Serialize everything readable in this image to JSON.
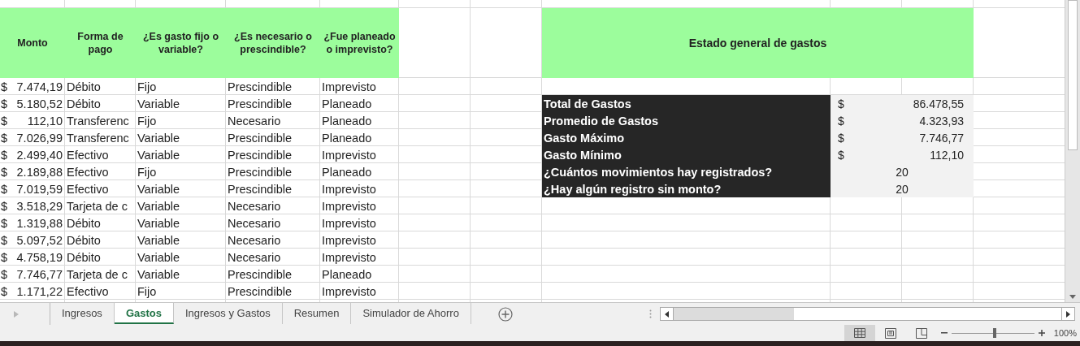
{
  "expense_table": {
    "columns": [
      {
        "label": "Monto"
      },
      {
        "label": "Forma de pago"
      },
      {
        "label": "¿Es gasto fijo o variable?"
      },
      {
        "label": "¿Es necesario o prescindible?"
      },
      {
        "label": "¿Fue planeado o imprevisto?"
      }
    ],
    "rows": [
      {
        "currency": "$",
        "amount": "7.474,19",
        "payment": "Débito",
        "type": "Fijo",
        "necessity": "Prescindible",
        "planning": "Imprevisto"
      },
      {
        "currency": "$",
        "amount": "5.180,52",
        "payment": "Débito",
        "type": "Variable",
        "necessity": "Prescindible",
        "planning": "Planeado"
      },
      {
        "currency": "$",
        "amount": "112,10",
        "payment": "Transferenc",
        "type": "Fijo",
        "necessity": "Necesario",
        "planning": "Planeado"
      },
      {
        "currency": "$",
        "amount": "7.026,99",
        "payment": "Transferenc",
        "type": "Variable",
        "necessity": "Prescindible",
        "planning": "Planeado"
      },
      {
        "currency": "$",
        "amount": "2.499,40",
        "payment": "Efectivo",
        "type": "Variable",
        "necessity": "Prescindible",
        "planning": "Imprevisto"
      },
      {
        "currency": "$",
        "amount": "2.189,88",
        "payment": "Efectivo",
        "type": "Fijo",
        "necessity": "Prescindible",
        "planning": "Planeado"
      },
      {
        "currency": "$",
        "amount": "7.019,59",
        "payment": "Efectivo",
        "type": "Variable",
        "necessity": "Prescindible",
        "planning": "Imprevisto"
      },
      {
        "currency": "$",
        "amount": "3.518,29",
        "payment": "Tarjeta de c",
        "type": "Variable",
        "necessity": "Necesario",
        "planning": "Imprevisto"
      },
      {
        "currency": "$",
        "amount": "1.319,88",
        "payment": "Débito",
        "type": "Variable",
        "necessity": "Necesario",
        "planning": "Imprevisto"
      },
      {
        "currency": "$",
        "amount": "5.097,52",
        "payment": "Débito",
        "type": "Variable",
        "necessity": "Necesario",
        "planning": "Imprevisto"
      },
      {
        "currency": "$",
        "amount": "4.758,19",
        "payment": "Débito",
        "type": "Variable",
        "necessity": "Necesario",
        "planning": "Imprevisto"
      },
      {
        "currency": "$",
        "amount": "7.746,77",
        "payment": "Tarjeta de c",
        "type": "Variable",
        "necessity": "Prescindible",
        "planning": "Planeado"
      },
      {
        "currency": "$",
        "amount": "1.171,22",
        "payment": "Efectivo",
        "type": "Fijo",
        "necessity": "Prescindible",
        "planning": "Imprevisto"
      }
    ]
  },
  "summary": {
    "title": "Estado general de gastos",
    "rows": [
      {
        "kind": "money",
        "label": "Total de Gastos",
        "currency": "$",
        "value": "86.478,55"
      },
      {
        "kind": "money",
        "label": "Promedio de Gastos",
        "currency": "$",
        "value": "4.323,93"
      },
      {
        "kind": "money",
        "label": "Gasto Máximo",
        "currency": "$",
        "value": "7.746,77"
      },
      {
        "kind": "money",
        "label": "Gasto Mínimo",
        "currency": "$",
        "value": "112,10"
      },
      {
        "kind": "count",
        "label": "¿Cuántos movimientos hay registrados?",
        "value": "20"
      },
      {
        "kind": "count",
        "label": "¿Hay algún registro sin monto?",
        "value": "20"
      }
    ]
  },
  "sheet_tabs": [
    {
      "label": "Ingresos",
      "selected": false
    },
    {
      "label": "Gastos",
      "selected": true
    },
    {
      "label": "Ingresos y Gastos",
      "selected": false
    },
    {
      "label": "Resumen",
      "selected": false
    },
    {
      "label": "Simulador de Ahorro",
      "selected": false
    }
  ],
  "status_bar": {
    "zoom_slider": {
      "level": 0.52
    },
    "zoom": "100%"
  }
}
